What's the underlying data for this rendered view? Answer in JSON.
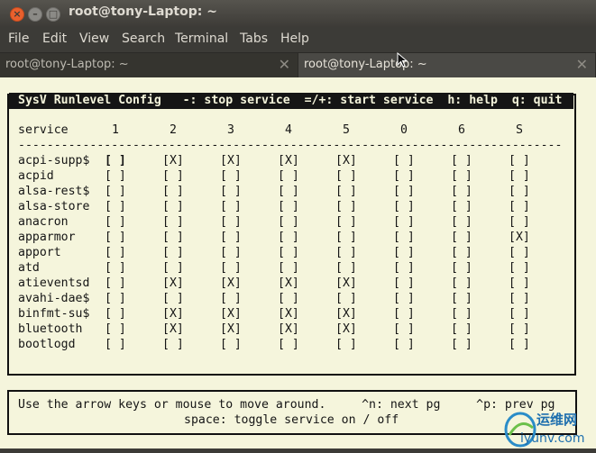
{
  "window": {
    "title": "root@tony-Laptop: ~",
    "close_glyph": "×",
    "min_glyph": "–",
    "max_glyph": "□"
  },
  "menu": [
    "File",
    "Edit",
    "View",
    "Search",
    "Terminal",
    "Tabs",
    "Help"
  ],
  "tabs": [
    {
      "label": "root@tony-Laptop: ~",
      "close": "✕"
    },
    {
      "label": "root@tony-Laptop: ~",
      "close": "✕"
    }
  ],
  "sysv": {
    "header": "SysV Runlevel Config   -: stop service  =/+: start service  h: help  q: quit",
    "column_title": "service",
    "runlevels": [
      "1",
      "2",
      "3",
      "4",
      "5",
      "0",
      "6",
      "S"
    ],
    "divider": "----------------------------------------------------------------------------",
    "services": [
      {
        "name": "acpi-supp$",
        "states": [
          "[ ]",
          "[X]",
          "[X]",
          "[X]",
          "[X]",
          "[ ]",
          "[ ]",
          "[ ]"
        ]
      },
      {
        "name": "acpid",
        "states": [
          "[ ]",
          "[ ]",
          "[ ]",
          "[ ]",
          "[ ]",
          "[ ]",
          "[ ]",
          "[ ]"
        ]
      },
      {
        "name": "alsa-rest$",
        "states": [
          "[ ]",
          "[ ]",
          "[ ]",
          "[ ]",
          "[ ]",
          "[ ]",
          "[ ]",
          "[ ]"
        ]
      },
      {
        "name": "alsa-store",
        "states": [
          "[ ]",
          "[ ]",
          "[ ]",
          "[ ]",
          "[ ]",
          "[ ]",
          "[ ]",
          "[ ]"
        ]
      },
      {
        "name": "anacron",
        "states": [
          "[ ]",
          "[ ]",
          "[ ]",
          "[ ]",
          "[ ]",
          "[ ]",
          "[ ]",
          "[ ]"
        ]
      },
      {
        "name": "apparmor",
        "states": [
          "[ ]",
          "[ ]",
          "[ ]",
          "[ ]",
          "[ ]",
          "[ ]",
          "[ ]",
          "[X]"
        ]
      },
      {
        "name": "apport",
        "states": [
          "[ ]",
          "[ ]",
          "[ ]",
          "[ ]",
          "[ ]",
          "[ ]",
          "[ ]",
          "[ ]"
        ]
      },
      {
        "name": "atd",
        "states": [
          "[ ]",
          "[ ]",
          "[ ]",
          "[ ]",
          "[ ]",
          "[ ]",
          "[ ]",
          "[ ]"
        ]
      },
      {
        "name": "atieventsd",
        "states": [
          "[ ]",
          "[X]",
          "[X]",
          "[X]",
          "[X]",
          "[ ]",
          "[ ]",
          "[ ]"
        ]
      },
      {
        "name": "avahi-dae$",
        "states": [
          "[ ]",
          "[ ]",
          "[ ]",
          "[ ]",
          "[ ]",
          "[ ]",
          "[ ]",
          "[ ]"
        ]
      },
      {
        "name": "binfmt-su$",
        "states": [
          "[ ]",
          "[X]",
          "[X]",
          "[X]",
          "[X]",
          "[ ]",
          "[ ]",
          "[ ]"
        ]
      },
      {
        "name": "bluetooth",
        "states": [
          "[ ]",
          "[X]",
          "[X]",
          "[X]",
          "[X]",
          "[ ]",
          "[ ]",
          "[ ]"
        ]
      },
      {
        "name": "bootlogd",
        "states": [
          "[ ]",
          "[ ]",
          "[ ]",
          "[ ]",
          "[ ]",
          "[ ]",
          "[ ]",
          "[ ]"
        ]
      }
    ],
    "footer_line1": "Use the arrow keys or mouse to move around.     ^n: next pg     ^p: prev pg",
    "footer_line2": "space: toggle service on / off"
  },
  "watermark": {
    "brand": "运维网",
    "domain": "iyunv.com"
  },
  "colors": {
    "terminal_bg": "#f5f5dc",
    "terminal_fg": "#151515",
    "chrome": "#3c3b37",
    "close_button": "#e9602d"
  }
}
